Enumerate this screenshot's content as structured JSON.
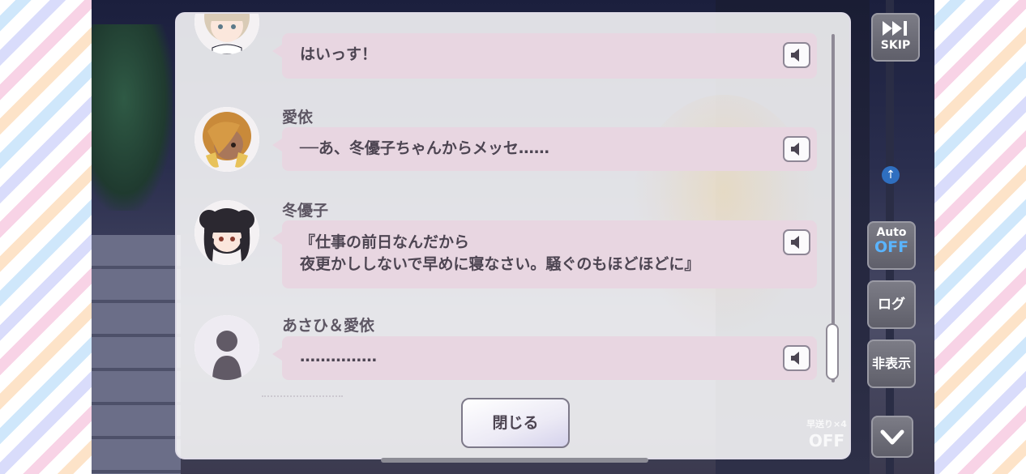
{
  "messages": [
    {
      "speaker": "",
      "text": "はいっす！",
      "avatar": "girl-light-hair-avatar"
    },
    {
      "speaker": "愛依",
      "text": "──あ、冬優子ちゃんからメッセ……",
      "avatar": "girl-blonde-avatar"
    },
    {
      "speaker": "冬優子",
      "text": "『仕事の前日なんだから\n夜更かししないで早めに寝なさい。騒ぐのもほどほどに』",
      "avatar": "girl-black-hair-avatar"
    },
    {
      "speaker": "あさひ＆愛依",
      "text": "……………",
      "avatar": "silhouette-avatar"
    }
  ],
  "close_label": "閉じる",
  "controls": {
    "skip": "SKIP",
    "auto_top": "Auto",
    "auto_bottom": "OFF",
    "log": "ログ",
    "hide": "非表示",
    "fast_forward_label": "早送り×4",
    "fast_forward_state": "OFF"
  },
  "colors": {
    "bubble": "#e8d6e1",
    "accent_off": "#5ab4ff",
    "button_gray": "#6b6b75"
  }
}
